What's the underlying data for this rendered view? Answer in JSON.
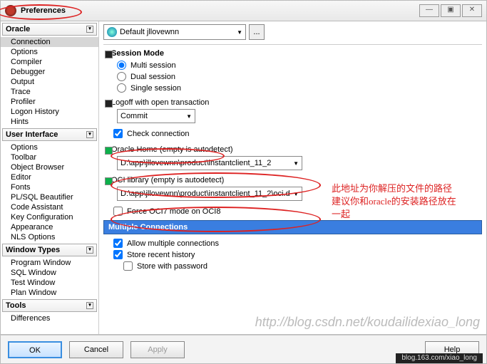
{
  "window": {
    "title": "Preferences"
  },
  "winbtns": {
    "min": "—",
    "max": "▣",
    "close": "✕"
  },
  "sidebar": {
    "cat1": "Oracle",
    "items1": [
      "Connection",
      "Options",
      "Compiler",
      "Debugger",
      "Output",
      "Trace",
      "Profiler",
      "Logon History",
      "Hints"
    ],
    "cat2": "User Interface",
    "items2": [
      "Options",
      "Toolbar",
      "Object Browser",
      "Editor",
      "Fonts",
      "PL/SQL Beautifier",
      "Code Assistant",
      "Key Configuration",
      "Appearance",
      "NLS Options"
    ],
    "cat3": "Window Types",
    "items3": [
      "Program Window",
      "SQL Window",
      "Test Window",
      "Plan Window"
    ],
    "cat4": "Tools",
    "items4": [
      "Differences"
    ]
  },
  "top": {
    "profile": "Default jllovewnn",
    "more": "..."
  },
  "session": {
    "title": "Session Mode",
    "opt1": "Multi session",
    "opt2": "Dual session",
    "opt3": "Single session",
    "logoff_label": "Logoff with open transaction",
    "logoff_val": "Commit",
    "check_conn": "Check connection"
  },
  "oracle_home": {
    "label": "Oracle Home (empty is autodetect)",
    "value": "D:\\app\\jllovewnn\\product\\instantclient_11_2"
  },
  "oci": {
    "label": "OCI library (empty is autodetect)",
    "value": "D:\\app\\jllovewnn\\product\\instantclient_11_2\\oci.d",
    "force7": "Force OCI7 mode on OCI8"
  },
  "multi": {
    "head": "Multiple Connections",
    "allow": "Allow multiple connections",
    "recent": "Store recent history",
    "pwd": "Store with password"
  },
  "buttons": {
    "ok": "OK",
    "cancel": "Cancel",
    "apply": "Apply",
    "help": "Help"
  },
  "annotation": "此地址为你解压的文件的路径建议你和oracle的安装路径放在一起",
  "watermark": "http://blog.csdn.net/koudailidexiao_long",
  "credit": "blog.163.com/xiao_long"
}
